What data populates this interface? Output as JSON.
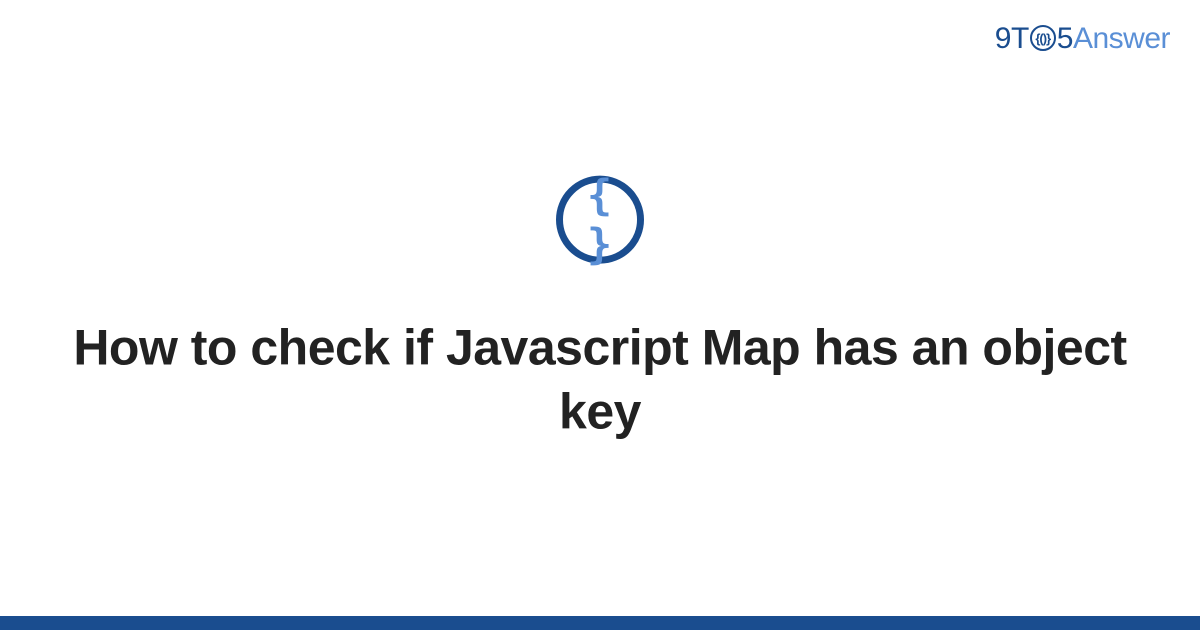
{
  "logo": {
    "nine": "9",
    "t": "T",
    "o_inner": "{()}",
    "five": "5",
    "answer": "Answer"
  },
  "icon": {
    "braces": "{ }"
  },
  "title": "How to check if Javascript Map has an object key"
}
